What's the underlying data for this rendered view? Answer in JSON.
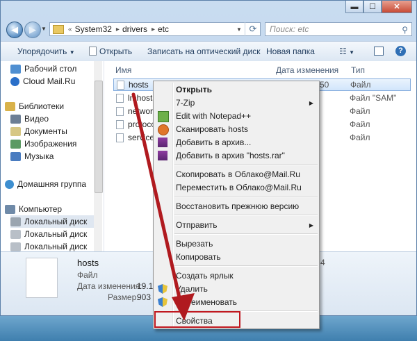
{
  "address": {
    "segments": [
      "System32",
      "drivers",
      "etc"
    ],
    "search_placeholder": "Поиск: etc"
  },
  "toolbar": {
    "organize": "Упорядочить",
    "open": "Открыть",
    "burn": "Записать на оптический диск",
    "new_folder": "Новая папка"
  },
  "nav": {
    "items": [
      "Рабочий стол",
      "Cloud Mail.Ru",
      "Библиотеки",
      "Видео",
      "Документы",
      "Изображения",
      "Музыка",
      "Домашняя группа",
      "Компьютер",
      "Локальный диск",
      "Локальный диск",
      "Локальный диск"
    ]
  },
  "columns": {
    "name": "Имя",
    "date": "Дата изменения",
    "type": "Тип"
  },
  "files": [
    {
      "name": "hosts",
      "date_tail": "50",
      "type": "Файл"
    },
    {
      "name": "lmhosts.",
      "type": "Файл \"SAM\""
    },
    {
      "name": "network",
      "type": "Файл"
    },
    {
      "name": "protocol",
      "type": "Файл"
    },
    {
      "name": "services",
      "type": "Файл"
    }
  ],
  "details": {
    "name": "hosts",
    "type": "Файл",
    "date_label": "Дата изменения:",
    "date_value": "19.11",
    "size_label": "Размер:",
    "size_value": "903 б",
    "right_digit": "4"
  },
  "context_menu": {
    "open": "Открыть",
    "seven_zip": "7-Zip",
    "notepad": "Edit with Notepad++",
    "scan": "Сканировать hosts",
    "add_archive": "Добавить в архив...",
    "add_rar": "Добавить в архив \"hosts.rar\"",
    "copy_cloud": "Скопировать в Облако@Mail.Ru",
    "move_cloud": "Переместить в Облако@Mail.Ru",
    "restore": "Восстановить прежнюю версию",
    "send_to": "Отправить",
    "cut": "Вырезать",
    "copy": "Копировать",
    "shortcut": "Создать ярлык",
    "delete": "Удалить",
    "rename": "Переименовать",
    "properties": "Свойства"
  },
  "colors": {
    "highlight_box": "#c0181f",
    "arrow": "#b01a1f"
  }
}
